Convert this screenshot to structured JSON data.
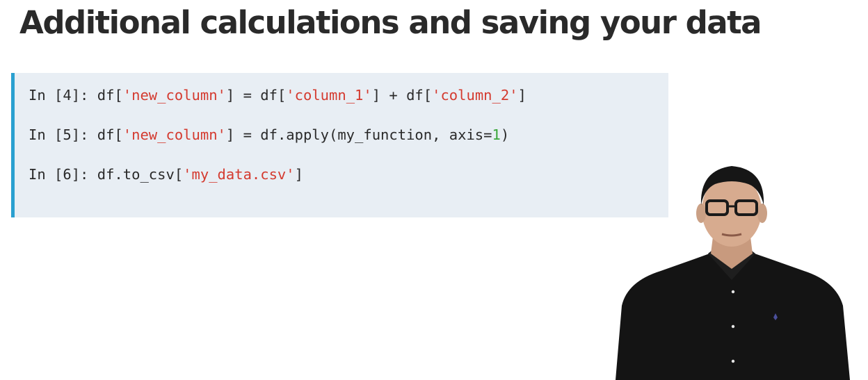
{
  "slide": {
    "title": "Additional calculations and saving your data"
  },
  "code": {
    "lines": [
      {
        "prompt": "In [4]: ",
        "parts": [
          {
            "text": "df[",
            "kind": "plain"
          },
          {
            "text": "'new_column'",
            "kind": "string"
          },
          {
            "text": "] = df[",
            "kind": "plain"
          },
          {
            "text": "'column_1'",
            "kind": "string"
          },
          {
            "text": "] + df[",
            "kind": "plain"
          },
          {
            "text": "'column_2'",
            "kind": "string"
          },
          {
            "text": "]",
            "kind": "plain"
          }
        ]
      },
      {
        "prompt": "In [5]: ",
        "parts": [
          {
            "text": "df[",
            "kind": "plain"
          },
          {
            "text": "'new_column'",
            "kind": "string"
          },
          {
            "text": "] = df.apply(my_function, axis=",
            "kind": "plain"
          },
          {
            "text": "1",
            "kind": "number"
          },
          {
            "text": ")",
            "kind": "plain"
          }
        ]
      },
      {
        "prompt": "In [6]: ",
        "parts": [
          {
            "text": "df.to_csv[",
            "kind": "plain"
          },
          {
            "text": "'my_data.csv'",
            "kind": "string"
          },
          {
            "text": "]",
            "kind": "plain"
          }
        ]
      }
    ]
  },
  "colors": {
    "accent_bar": "#2aa0d0",
    "code_background": "#e8eef4",
    "string": "#d43a2f",
    "number": "#3aa63a"
  },
  "presenter": {
    "icon": "presenter-video-figure"
  }
}
